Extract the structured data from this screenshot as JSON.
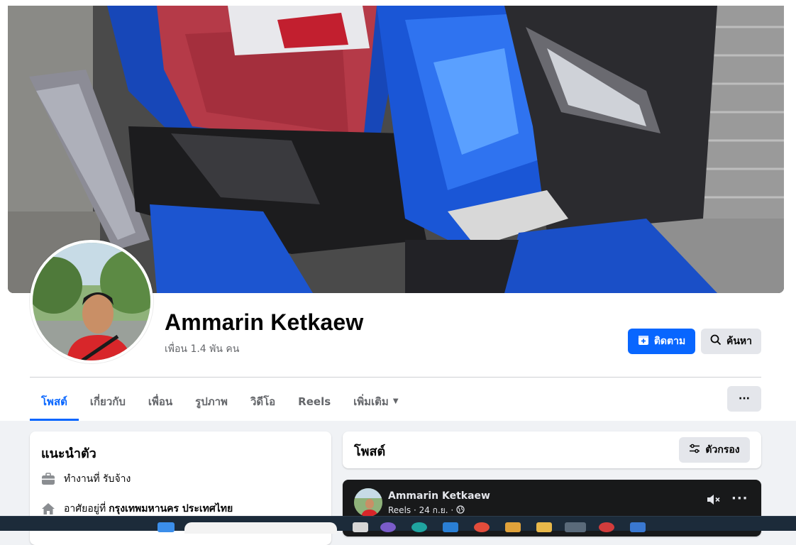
{
  "profile": {
    "name": "Ammarin Ketkaew",
    "friends": "เพื่อน 1.4 พัน คน"
  },
  "actions": {
    "follow_label": "ติดตาม",
    "search_label": "ค้นหา",
    "more_label": "···"
  },
  "tabs": [
    {
      "label": "โพสต์",
      "active": true
    },
    {
      "label": "เกี่ยวกับ",
      "active": false
    },
    {
      "label": "เพื่อน",
      "active": false
    },
    {
      "label": "รูปภาพ",
      "active": false
    },
    {
      "label": "วิดีโอ",
      "active": false
    },
    {
      "label": "Reels",
      "active": false
    },
    {
      "label": "เพิ่มเติม",
      "active": false
    }
  ],
  "intro": {
    "title": "แนะนำตัว",
    "work_text": "ทำงานที่ รับจ้าง",
    "lives_prefix": "อาศัยอยู่ที่",
    "lives_place": "กรุงเทพมหานคร ประเทศไทย"
  },
  "posts_header": {
    "title": "โพสต์",
    "filter_label": "ตัวกรอง"
  },
  "post": {
    "author": "Ammarin Ketkaew",
    "meta": "Reels · 24 ก.ย. ·"
  },
  "colors": {
    "accent": "#0866ff",
    "secondary_button": "#e4e6eb",
    "muted_text": "#65676b",
    "page_bg": "#f0f2f5"
  }
}
